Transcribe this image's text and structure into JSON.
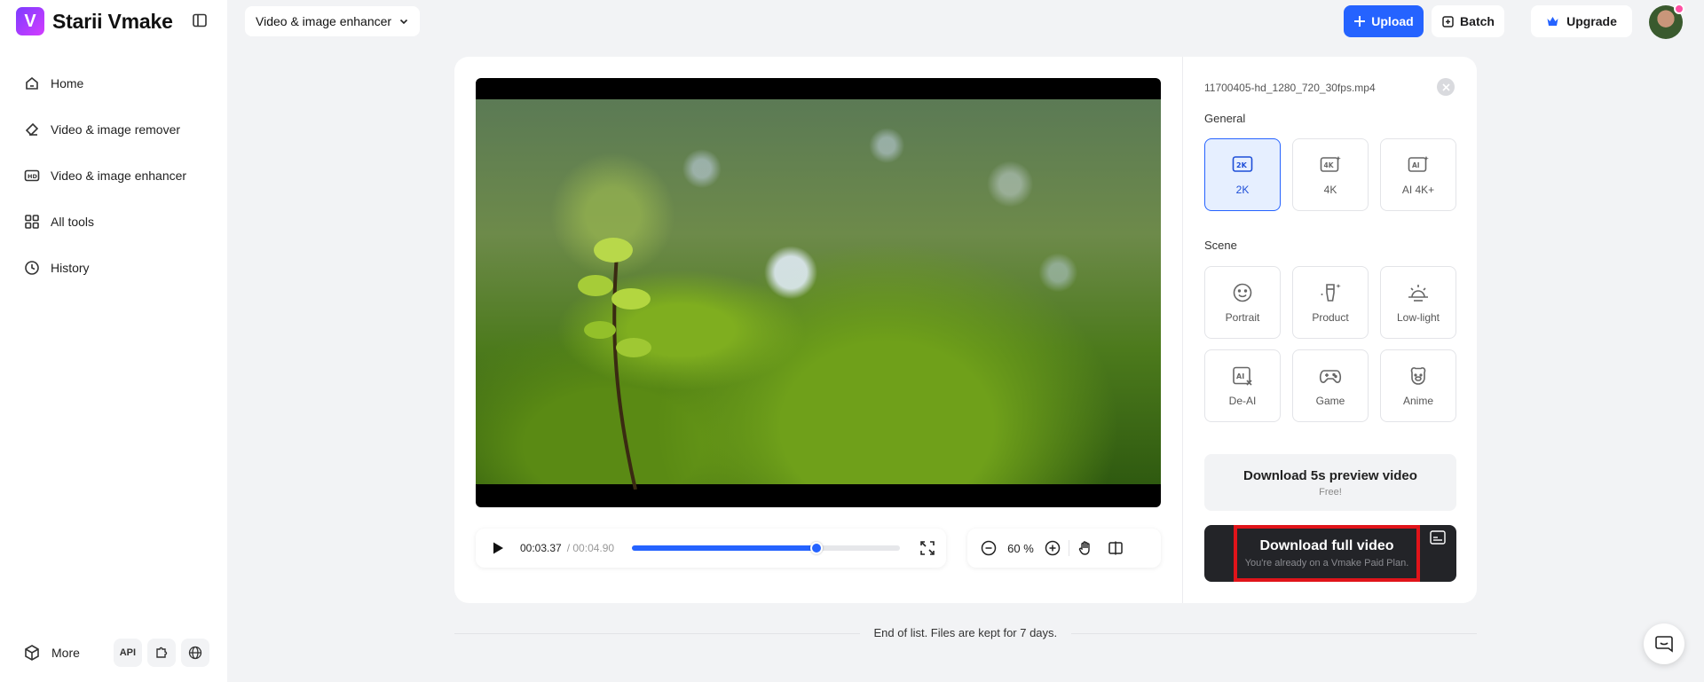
{
  "app": {
    "name": "Starii Vmake",
    "logo_letter": "V"
  },
  "sidebar": {
    "items": [
      {
        "label": "Home",
        "icon": "home-icon"
      },
      {
        "label": "Video & image remover",
        "icon": "eraser-icon"
      },
      {
        "label": "Video & image enhancer",
        "icon": "hd-icon"
      },
      {
        "label": "All tools",
        "icon": "grid-icon"
      },
      {
        "label": "History",
        "icon": "clock-icon"
      }
    ],
    "more_label": "More",
    "api_label": "API"
  },
  "header": {
    "tool_select": "Video & image enhancer",
    "upload_label": "Upload",
    "batch_label": "Batch",
    "upgrade_label": "Upgrade"
  },
  "player": {
    "current_time": "00:03.37",
    "total_time": "/ 00:04.90",
    "progress": 0.69,
    "zoom": "60 %"
  },
  "panel": {
    "file_name": "11700405-hd_1280_720_30fps.mp4",
    "general_label": "General",
    "general_options": [
      {
        "label": "2K",
        "icon": "2k-icon",
        "selected": true
      },
      {
        "label": "4K",
        "icon": "4k-icon",
        "selected": false
      },
      {
        "label": "AI 4K+",
        "icon": "ai-4k-icon",
        "selected": false
      }
    ],
    "scene_label": "Scene",
    "scene_options": [
      {
        "label": "Portrait",
        "icon": "smile-icon"
      },
      {
        "label": "Product",
        "icon": "product-icon"
      },
      {
        "label": "Low-light",
        "icon": "sunrise-icon"
      },
      {
        "label": "De-AI",
        "icon": "de-ai-icon"
      },
      {
        "label": "Game",
        "icon": "gamepad-icon"
      },
      {
        "label": "Anime",
        "icon": "bear-icon"
      }
    ],
    "preview_title": "Download 5s preview video",
    "preview_sub": "Free!",
    "full_title": "Download full video",
    "full_sub": "You're already on a Vmake Paid Plan."
  },
  "footer": {
    "text": "End of list. Files are kept for 7 days."
  },
  "colors": {
    "accent": "#2563ff",
    "dark_button": "#232428",
    "highlight": "#e0141a",
    "background": "#f2f3f5"
  }
}
